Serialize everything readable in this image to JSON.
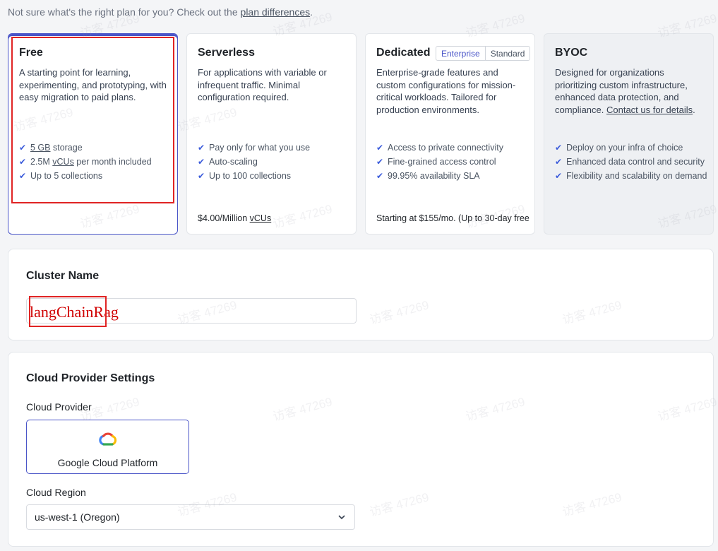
{
  "notice": {
    "text": "Not sure what's the right plan for you? Check out the ",
    "link": "plan differences",
    "suffix": "."
  },
  "plans": [
    {
      "title": "Free",
      "description": "A starting point for learning, experimenting, and prototyping, with easy migration to paid plans.",
      "features": [
        {
          "pre": "",
          "u": "5 GB",
          "post": " storage"
        },
        {
          "pre": "2.5M ",
          "u": "vCUs",
          "post": " per month included"
        },
        {
          "pre": "Up to 5 collections",
          "u": "",
          "post": ""
        }
      ],
      "price": ""
    },
    {
      "title": "Serverless",
      "description": "For applications with variable or infrequent traffic. Minimal configuration required.",
      "features": [
        {
          "pre": "Pay only for what you use",
          "u": "",
          "post": ""
        },
        {
          "pre": "Auto-scaling",
          "u": "",
          "post": ""
        },
        {
          "pre": "Up to 100 collections",
          "u": "",
          "post": ""
        }
      ],
      "price_pre": "$4.00/Million ",
      "price_u": "vCUs"
    },
    {
      "title": "Dedicated",
      "tabs": [
        "Enterprise",
        "Standard"
      ],
      "description": "Enterprise-grade features and custom configurations for mission-critical workloads. Tailored for production environments.",
      "features": [
        {
          "pre": "Access to private connectivity",
          "u": "",
          "post": ""
        },
        {
          "pre": "Fine-grained access control",
          "u": "",
          "post": ""
        },
        {
          "pre": "99.95% availability SLA",
          "u": "",
          "post": ""
        }
      ],
      "price": "Starting at $155/mo. (Up to 30-day free"
    },
    {
      "title": "BYOC",
      "description": "Designed for organizations prioritizing custom infrastructure, enhanced data protection, and compliance. ",
      "description_link": "Contact us for details",
      "description_suffix": ".",
      "features": [
        {
          "pre": "Deploy on your infra of choice",
          "u": "",
          "post": ""
        },
        {
          "pre": "Enhanced data control and security",
          "u": "",
          "post": ""
        },
        {
          "pre": "Flexibility and scalability on demand",
          "u": "",
          "post": ""
        }
      ]
    }
  ],
  "cluster": {
    "title": "Cluster Name",
    "value": "langChainRag"
  },
  "cloud": {
    "title": "Cloud Provider Settings",
    "provider_label": "Cloud Provider",
    "provider_name": "Google Cloud Platform",
    "region_label": "Cloud Region",
    "region_value": "us-west-1 (Oregon)"
  },
  "watermark": "访客 47269",
  "colors": {
    "accent": "#4a55c8",
    "check": "#3b5bdb",
    "highlight": "#e02424"
  },
  "icons": {
    "feature": "check-icon",
    "provider": "google-cloud-icon",
    "select": "chevron-down-icon"
  }
}
